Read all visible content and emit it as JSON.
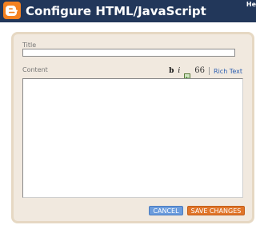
{
  "header": {
    "title": "Configure HTML/JavaScript",
    "help": "He"
  },
  "form": {
    "title_label": "Title",
    "title_value": "",
    "content_label": "Content",
    "content_value": ""
  },
  "toolbar": {
    "bold": "b",
    "italic": "i",
    "image_icon": "image-icon",
    "quote": "66",
    "rich_text": "Rich Text"
  },
  "buttons": {
    "cancel": "CANCEL",
    "save": "SAVE CHANGES"
  },
  "colors": {
    "header_bg": "#22375a",
    "logo": "#f48120",
    "panel_bg": "#f1e9df",
    "cancel_bg": "#6a9bdc",
    "save_bg": "#e0752a"
  }
}
